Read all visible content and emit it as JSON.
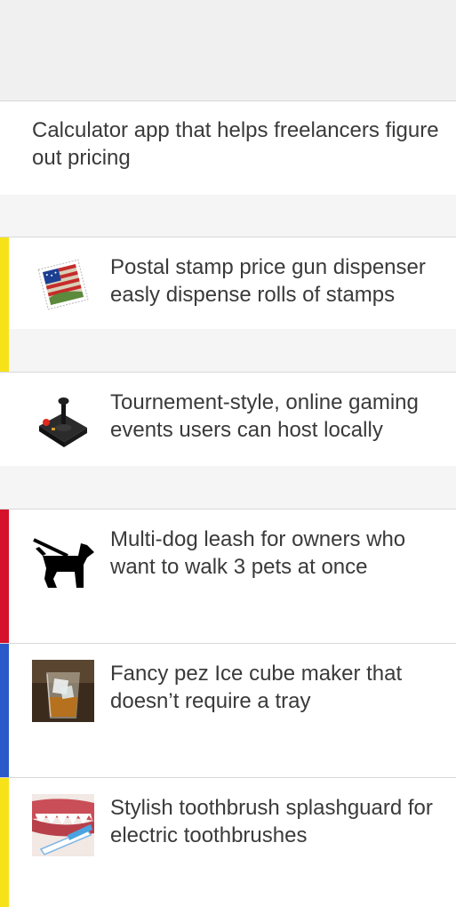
{
  "colors": {
    "yellow": "#f7e21a",
    "red": "#d6112b",
    "blue": "#2a59c9"
  },
  "ideas": [
    {
      "text": "Calculator app that helps freelancers figure out pricing",
      "icon": ""
    },
    {
      "text": "Postal stamp price gun dispenser easly dispense rolls of stamps",
      "icon": "postage-stamp-icon"
    },
    {
      "text": "Tournement-style, online gaming events users can host locally",
      "icon": "joystick-icon"
    },
    {
      "text": "Multi-dog leash for owners who want to walk 3 pets at once",
      "icon": "dog-on-leash-icon"
    },
    {
      "text": "Fancy pez Ice cube maker that doesn’t require a tray",
      "icon": "ice-cube-glass-photo"
    },
    {
      "text": "Stylish toothbrush splashguard for electric toothbrushes",
      "icon": "toothbrush-photo"
    }
  ]
}
